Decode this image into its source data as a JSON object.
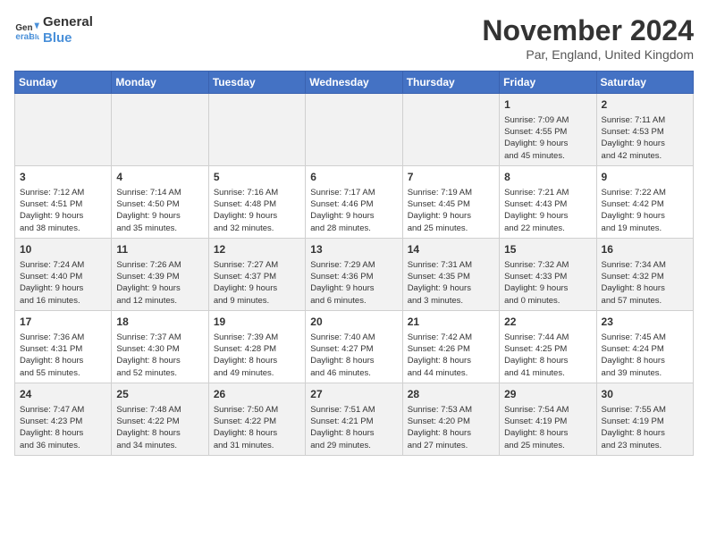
{
  "logo": {
    "line1": "General",
    "line2": "Blue"
  },
  "title": "November 2024",
  "location": "Par, England, United Kingdom",
  "weekdays": [
    "Sunday",
    "Monday",
    "Tuesday",
    "Wednesday",
    "Thursday",
    "Friday",
    "Saturday"
  ],
  "weeks": [
    [
      {
        "day": "",
        "info": ""
      },
      {
        "day": "",
        "info": ""
      },
      {
        "day": "",
        "info": ""
      },
      {
        "day": "",
        "info": ""
      },
      {
        "day": "",
        "info": ""
      },
      {
        "day": "1",
        "info": "Sunrise: 7:09 AM\nSunset: 4:55 PM\nDaylight: 9 hours\nand 45 minutes."
      },
      {
        "day": "2",
        "info": "Sunrise: 7:11 AM\nSunset: 4:53 PM\nDaylight: 9 hours\nand 42 minutes."
      }
    ],
    [
      {
        "day": "3",
        "info": "Sunrise: 7:12 AM\nSunset: 4:51 PM\nDaylight: 9 hours\nand 38 minutes."
      },
      {
        "day": "4",
        "info": "Sunrise: 7:14 AM\nSunset: 4:50 PM\nDaylight: 9 hours\nand 35 minutes."
      },
      {
        "day": "5",
        "info": "Sunrise: 7:16 AM\nSunset: 4:48 PM\nDaylight: 9 hours\nand 32 minutes."
      },
      {
        "day": "6",
        "info": "Sunrise: 7:17 AM\nSunset: 4:46 PM\nDaylight: 9 hours\nand 28 minutes."
      },
      {
        "day": "7",
        "info": "Sunrise: 7:19 AM\nSunset: 4:45 PM\nDaylight: 9 hours\nand 25 minutes."
      },
      {
        "day": "8",
        "info": "Sunrise: 7:21 AM\nSunset: 4:43 PM\nDaylight: 9 hours\nand 22 minutes."
      },
      {
        "day": "9",
        "info": "Sunrise: 7:22 AM\nSunset: 4:42 PM\nDaylight: 9 hours\nand 19 minutes."
      }
    ],
    [
      {
        "day": "10",
        "info": "Sunrise: 7:24 AM\nSunset: 4:40 PM\nDaylight: 9 hours\nand 16 minutes."
      },
      {
        "day": "11",
        "info": "Sunrise: 7:26 AM\nSunset: 4:39 PM\nDaylight: 9 hours\nand 12 minutes."
      },
      {
        "day": "12",
        "info": "Sunrise: 7:27 AM\nSunset: 4:37 PM\nDaylight: 9 hours\nand 9 minutes."
      },
      {
        "day": "13",
        "info": "Sunrise: 7:29 AM\nSunset: 4:36 PM\nDaylight: 9 hours\nand 6 minutes."
      },
      {
        "day": "14",
        "info": "Sunrise: 7:31 AM\nSunset: 4:35 PM\nDaylight: 9 hours\nand 3 minutes."
      },
      {
        "day": "15",
        "info": "Sunrise: 7:32 AM\nSunset: 4:33 PM\nDaylight: 9 hours\nand 0 minutes."
      },
      {
        "day": "16",
        "info": "Sunrise: 7:34 AM\nSunset: 4:32 PM\nDaylight: 8 hours\nand 57 minutes."
      }
    ],
    [
      {
        "day": "17",
        "info": "Sunrise: 7:36 AM\nSunset: 4:31 PM\nDaylight: 8 hours\nand 55 minutes."
      },
      {
        "day": "18",
        "info": "Sunrise: 7:37 AM\nSunset: 4:30 PM\nDaylight: 8 hours\nand 52 minutes."
      },
      {
        "day": "19",
        "info": "Sunrise: 7:39 AM\nSunset: 4:28 PM\nDaylight: 8 hours\nand 49 minutes."
      },
      {
        "day": "20",
        "info": "Sunrise: 7:40 AM\nSunset: 4:27 PM\nDaylight: 8 hours\nand 46 minutes."
      },
      {
        "day": "21",
        "info": "Sunrise: 7:42 AM\nSunset: 4:26 PM\nDaylight: 8 hours\nand 44 minutes."
      },
      {
        "day": "22",
        "info": "Sunrise: 7:44 AM\nSunset: 4:25 PM\nDaylight: 8 hours\nand 41 minutes."
      },
      {
        "day": "23",
        "info": "Sunrise: 7:45 AM\nSunset: 4:24 PM\nDaylight: 8 hours\nand 39 minutes."
      }
    ],
    [
      {
        "day": "24",
        "info": "Sunrise: 7:47 AM\nSunset: 4:23 PM\nDaylight: 8 hours\nand 36 minutes."
      },
      {
        "day": "25",
        "info": "Sunrise: 7:48 AM\nSunset: 4:22 PM\nDaylight: 8 hours\nand 34 minutes."
      },
      {
        "day": "26",
        "info": "Sunrise: 7:50 AM\nSunset: 4:22 PM\nDaylight: 8 hours\nand 31 minutes."
      },
      {
        "day": "27",
        "info": "Sunrise: 7:51 AM\nSunset: 4:21 PM\nDaylight: 8 hours\nand 29 minutes."
      },
      {
        "day": "28",
        "info": "Sunrise: 7:53 AM\nSunset: 4:20 PM\nDaylight: 8 hours\nand 27 minutes."
      },
      {
        "day": "29",
        "info": "Sunrise: 7:54 AM\nSunset: 4:19 PM\nDaylight: 8 hours\nand 25 minutes."
      },
      {
        "day": "30",
        "info": "Sunrise: 7:55 AM\nSunset: 4:19 PM\nDaylight: 8 hours\nand 23 minutes."
      }
    ]
  ]
}
